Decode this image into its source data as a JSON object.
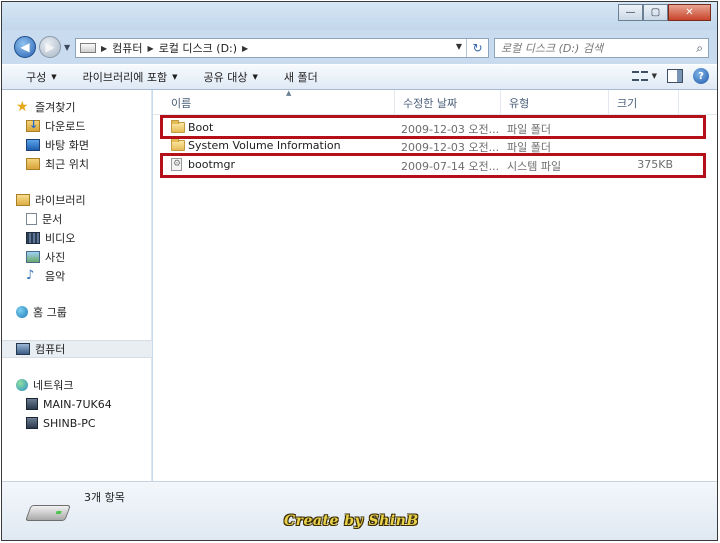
{
  "window": {
    "minimize_glyph": "—",
    "maximize_glyph": "▢",
    "close_glyph": "✕"
  },
  "address": {
    "segments": [
      "컴퓨터",
      "로컬 디스크 (D:)"
    ],
    "refresh_glyph": "↻"
  },
  "search": {
    "placeholder": "로컬 디스크 (D:) 검색"
  },
  "toolbar": {
    "organize": "구성",
    "include_library": "라이브러리에 포함",
    "share": "공유 대상",
    "new_folder": "새 폴더"
  },
  "nav": {
    "favorites": "즐겨찾기",
    "downloads": "다운로드",
    "desktop": "바탕 화면",
    "recent": "최근 위치",
    "libraries": "라이브러리",
    "documents": "문서",
    "videos": "비디오",
    "pictures": "사진",
    "music": "음악",
    "homegroup": "홈 그룹",
    "computer": "컴퓨터",
    "network": "네트워크",
    "pc1": "MAIN-7UK64",
    "pc2": "SHINB-PC"
  },
  "columns": {
    "name": "이름",
    "modified": "수정한 날짜",
    "type": "유형",
    "size": "크기"
  },
  "files": [
    {
      "name": "Boot",
      "modified": "2009-12-03 오전...",
      "type": "파일 폴더",
      "size": "",
      "icon": "folder-icon",
      "highlighted": true
    },
    {
      "name": "System Volume Information",
      "modified": "2009-12-03 오전...",
      "type": "파일 폴더",
      "size": "",
      "icon": "folder-icon",
      "highlighted": false
    },
    {
      "name": "bootmgr",
      "modified": "2009-07-14 오전...",
      "type": "시스템 파일",
      "size": "375KB",
      "icon": "system-file-icon",
      "highlighted": true
    }
  ],
  "details": {
    "item_count": "3개 항목"
  },
  "watermark": "Create by ShinB",
  "colors": {
    "highlight": "#b4101a",
    "frame": "#c9dcef"
  }
}
